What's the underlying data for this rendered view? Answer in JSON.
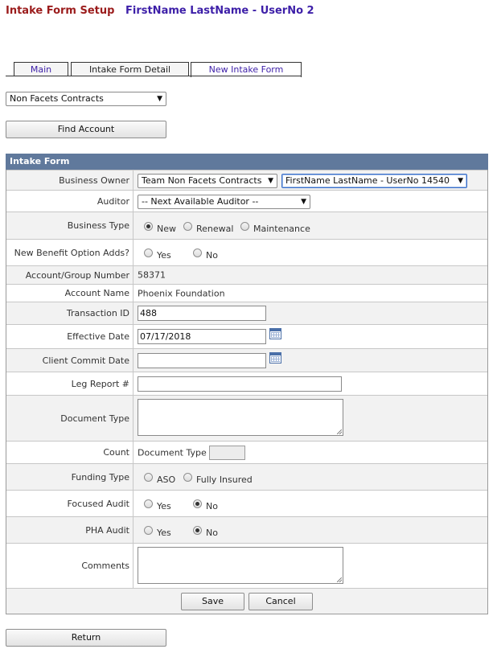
{
  "header": {
    "title": "Intake Form Setup",
    "user": "FirstName LastName - UserNo 2"
  },
  "tabs": [
    {
      "label": "Main",
      "active": false
    },
    {
      "label": "Intake Form Detail",
      "active": false
    },
    {
      "label": "New Intake Form",
      "active": true
    }
  ],
  "contract_select": {
    "value": "Non Facets Contracts"
  },
  "find_account_button": "Find Account",
  "form": {
    "title": "Intake Form",
    "business_owner": {
      "label": "Business Owner",
      "team": "Team Non Facets Contracts",
      "user": "FirstName LastName - UserNo 14540"
    },
    "auditor": {
      "label": "Auditor",
      "value": "-- Next Available Auditor --"
    },
    "business_type": {
      "label": "Business Type",
      "options": [
        "New",
        "Renewal",
        "Maintenance"
      ],
      "selected": "New"
    },
    "benefit_option": {
      "label": "New Benefit Option Adds?",
      "options": [
        "Yes",
        "No"
      ],
      "selected": ""
    },
    "account_number": {
      "label": "Account/Group Number",
      "value": "58371"
    },
    "account_name": {
      "label": "Account Name",
      "value": "Phoenix Foundation"
    },
    "transaction_id": {
      "label": "Transaction ID",
      "value": "488"
    },
    "effective_date": {
      "label": "Effective Date",
      "value": "07/17/2018"
    },
    "client_commit_date": {
      "label": "Client Commit Date",
      "value": ""
    },
    "leg_report": {
      "label": "Leg Report #",
      "value": ""
    },
    "document_type": {
      "label": "Document Type",
      "value": ""
    },
    "count": {
      "label": "Count",
      "sublabel": "Document Type",
      "value": ""
    },
    "funding_type": {
      "label": "Funding Type",
      "options": [
        "ASO",
        "Fully Insured"
      ],
      "selected": ""
    },
    "focused_audit": {
      "label": "Focused Audit",
      "options": [
        "Yes",
        "No"
      ],
      "selected": "No"
    },
    "pha_audit": {
      "label": "PHA Audit",
      "options": [
        "Yes",
        "No"
      ],
      "selected": "No"
    },
    "comments": {
      "label": "Comments",
      "value": ""
    }
  },
  "buttons": {
    "save": "Save",
    "cancel": "Cancel",
    "return": "Return"
  },
  "colors": {
    "title_red": "#9b1c1c",
    "user_purple": "#3d1fa8",
    "form_header": "#60799c"
  },
  "icons": {
    "calendar": "calendar-icon",
    "dropdown": "dropdown-arrow-icon"
  }
}
